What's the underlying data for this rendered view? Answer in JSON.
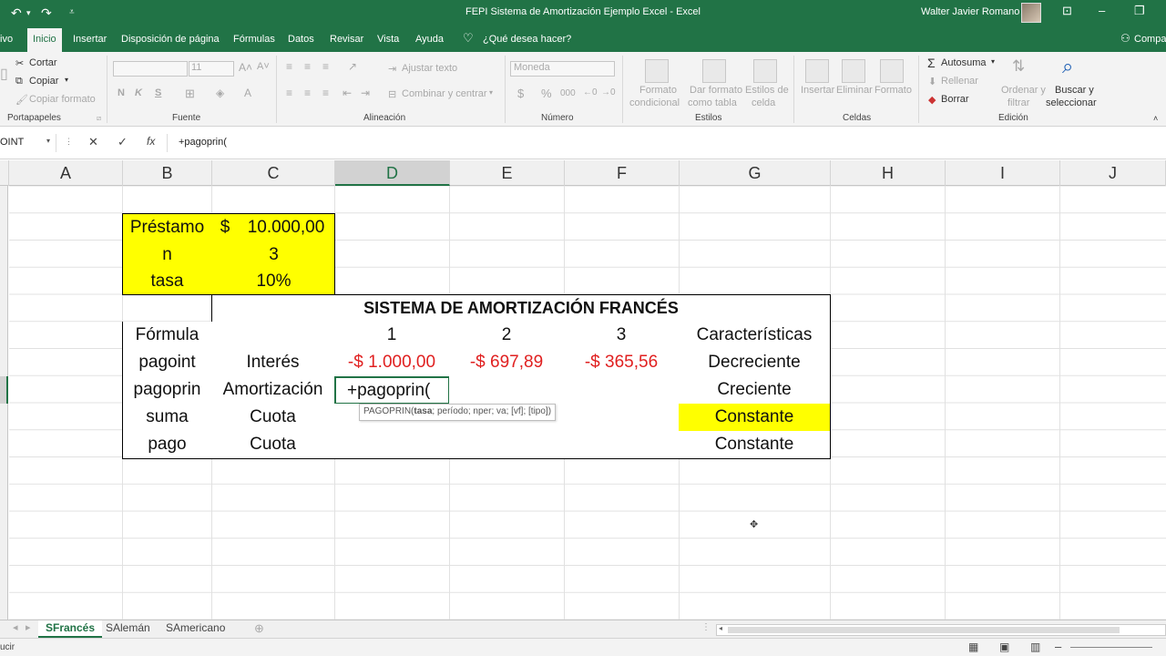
{
  "window": {
    "title": "FEPI Sistema de Amortización Ejemplo Excel  -  Excel",
    "user": "Walter Javier Romano",
    "undo_icon": "↶",
    "redo_icon": "↷",
    "min_icon": "–",
    "restore_icon": "❐",
    "close_icon": "✕",
    "ribbon_display_icon": "⊡"
  },
  "ribbon_tabs": [
    "ivo",
    "Inicio",
    "Insertar",
    "Disposición de página",
    "Fórmulas",
    "Datos",
    "Revisar",
    "Vista",
    "Ayuda"
  ],
  "tell_me": "¿Qué desea hacer?",
  "share": "Compar",
  "clipboard": {
    "cut": "Cortar",
    "copy": "Copiar",
    "format_painter": "Copiar formato",
    "group": "Portapapeles"
  },
  "font": {
    "size": "11",
    "bold": "N",
    "italic": "K",
    "underline": "S",
    "group": "Fuente"
  },
  "alignment": {
    "wrap": "Ajustar texto",
    "merge": "Combinar y centrar",
    "group": "Alineación"
  },
  "number": {
    "format": "Moneda",
    "currency": "$",
    "percent": "%",
    "thousands": "000",
    "group": "Número"
  },
  "styles": {
    "conditional": [
      "Formato",
      "condicional"
    ],
    "as_table": [
      "Dar formato",
      "como tabla"
    ],
    "cell_styles": [
      "Estilos de",
      "celda"
    ],
    "group": "Estilos"
  },
  "cells": {
    "insert": "Insertar",
    "delete": "Eliminar",
    "format": "Formato",
    "group": "Celdas"
  },
  "editing": {
    "autosum": "Autosuma",
    "fill": "Rellenar",
    "clear": "Borrar",
    "sort": [
      "Ordenar y",
      "filtrar"
    ],
    "find": [
      "Buscar y",
      "seleccionar"
    ],
    "group": "Edición"
  },
  "formula_bar": {
    "name_box": "OINT",
    "cancel": "✕",
    "enter": "✓",
    "fx": "fx",
    "content": "+pagoprin("
  },
  "columns": [
    "A",
    "B",
    "C",
    "D",
    "E",
    "F",
    "G",
    "H",
    "I",
    "J"
  ],
  "selected_column": "D",
  "sheet": {
    "loan": {
      "label": "Préstamo",
      "currency": "$",
      "amount": "10.000,00"
    },
    "n": {
      "label": "n",
      "value": "3"
    },
    "rate": {
      "label": "tasa",
      "value": "10%"
    },
    "table_title": "SISTEMA DE AMORTIZACIÓN FRANCÉS",
    "header": {
      "formula": "Fórmula",
      "p1": "1",
      "p2": "2",
      "p3": "3",
      "features": "Características"
    },
    "rows": [
      {
        "formula": "pagoint",
        "concept": "Interés",
        "p1": "-$ 1.000,00",
        "p2": "-$ 697,89",
        "p3": "-$ 365,56",
        "feature": "Decreciente"
      },
      {
        "formula": "pagoprin",
        "concept": "Amortización",
        "p1": "+pagoprin(",
        "p2": "",
        "p3": "",
        "feature": "Creciente"
      },
      {
        "formula": "suma",
        "concept": "Cuota",
        "p1": "",
        "p2": "",
        "p3": "",
        "feature": "Constante"
      },
      {
        "formula": "pago",
        "concept": "Cuota",
        "p1": "",
        "p2": "",
        "p3": "",
        "feature": "Constante"
      }
    ]
  },
  "tooltip": {
    "fn": "PAGOPRIN(",
    "bold_arg": "tasa",
    "rest": "; período; nper; va; [vf]; [tipo])"
  },
  "sheet_tabs": [
    "SFrancés",
    "SAlemán",
    "SAmericano"
  ],
  "active_sheet": "SFrancés",
  "status": "ucir"
}
